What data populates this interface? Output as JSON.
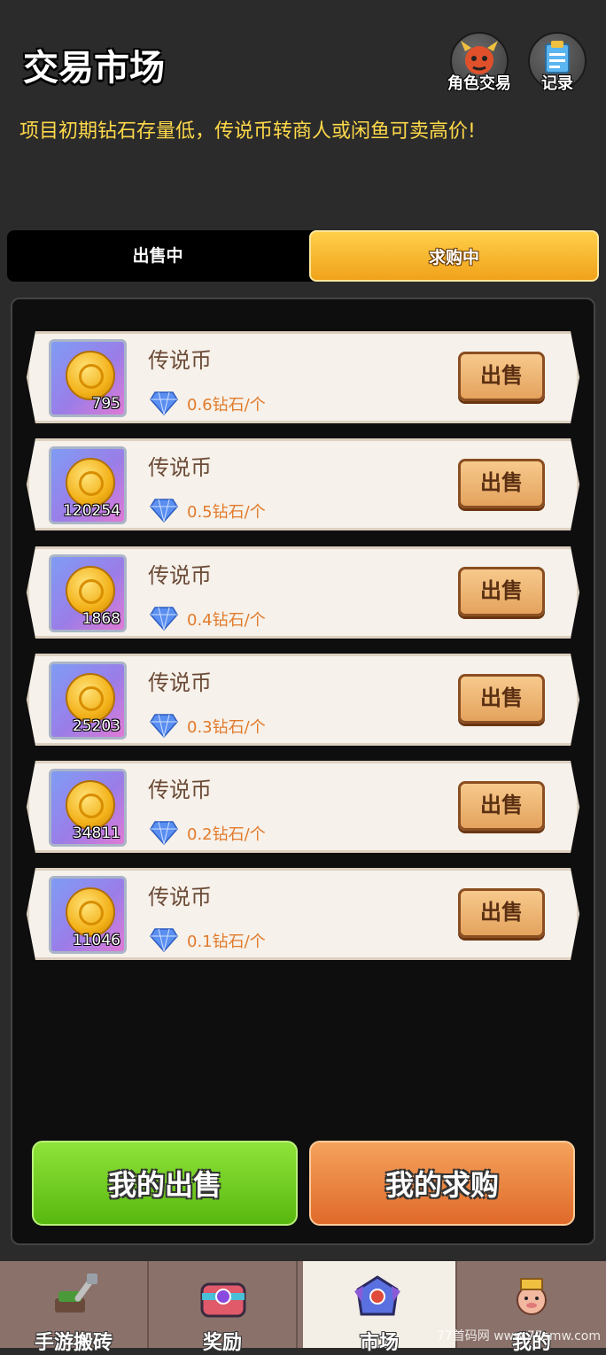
{
  "header": {
    "title": "交易市场",
    "role_trade_label": "角色交易",
    "records_label": "记录"
  },
  "notice": "项目初期钻石存量低，传说币转商人或闲鱼可卖高价!",
  "tabs": [
    {
      "label": "出售中",
      "active": false
    },
    {
      "label": "求购中",
      "active": true
    }
  ],
  "listings": [
    {
      "name": "传说币",
      "qty": "795",
      "price": "0.6钻石/个",
      "action": "出售"
    },
    {
      "name": "传说币",
      "qty": "120254",
      "price": "0.5钻石/个",
      "action": "出售"
    },
    {
      "name": "传说币",
      "qty": "1868",
      "price": "0.4钻石/个",
      "action": "出售"
    },
    {
      "name": "传说币",
      "qty": "25203",
      "price": "0.3钻石/个",
      "action": "出售"
    },
    {
      "name": "传说币",
      "qty": "34811",
      "price": "0.2钻石/个",
      "action": "出售"
    },
    {
      "name": "传说币",
      "qty": "11046",
      "price": "0.1钻石/个",
      "action": "出售"
    }
  ],
  "actions": {
    "my_sales": "我的出售",
    "my_purchases": "我的求购"
  },
  "nav": [
    {
      "label": "手游搬砖",
      "icon": "hammer-icon",
      "active": false
    },
    {
      "label": "奖励",
      "icon": "treasure-chest-icon",
      "active": false
    },
    {
      "label": "市场",
      "icon": "market-icon",
      "active": true
    },
    {
      "label": "我的",
      "icon": "avatar-icon",
      "active": false
    }
  ],
  "watermark": "77首码网 www.77smw.com"
}
